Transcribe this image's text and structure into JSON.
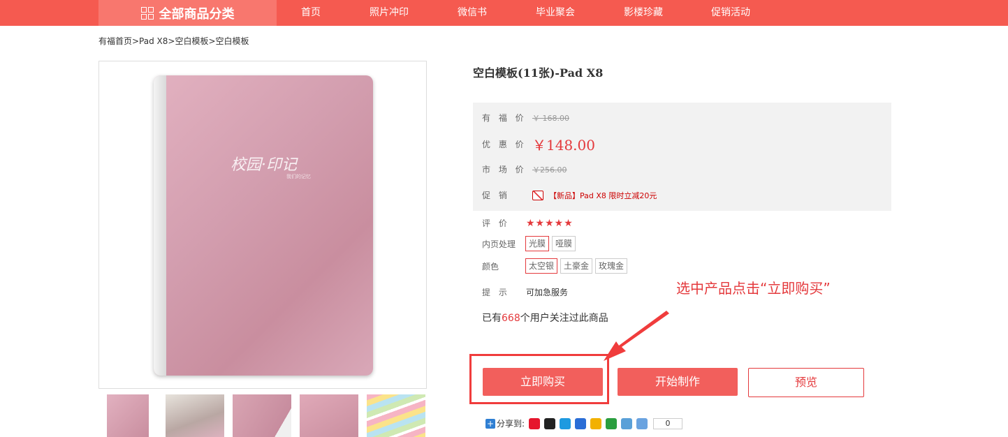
{
  "nav": {
    "all_categories": "全部商品分类",
    "items": [
      "首页",
      "照片冲印",
      "微信书",
      "毕业聚会",
      "影楼珍藏",
      "促销活动"
    ]
  },
  "breadcrumb": "有福首页>Pad X8>空白模板>空白模板",
  "album": {
    "title": "校园·印记",
    "subtitle": "我们的记忆"
  },
  "product": {
    "title": "空白模板(11张)-Pad X8",
    "youfu_label": "有 福 价",
    "youfu_price": "￥ 168.00",
    "promo_price_label": "优 惠 价",
    "promo_price": "￥148.00",
    "market_label": "市 场 价",
    "market_price": "￥256.00",
    "promotion_label": "促  销",
    "promotion_text": "【新品】Pad X8 限时立减20元",
    "rating_label": "评  价",
    "rating_stars": "★★★★★",
    "page_label": "内页处理",
    "page_options": [
      "光膜",
      "哑膜"
    ],
    "color_label": "颜色",
    "color_options": [
      "太空银",
      "土豪金",
      "玫瑰金"
    ],
    "tip_label": "提  示",
    "tip_text": "可加急服务",
    "followers_prefix": "已有",
    "followers_count": "668",
    "followers_suffix": "个用户关注过此商品"
  },
  "annotation": "选中产品点击“立即购买”",
  "buttons": {
    "buy": "立即购买",
    "make": "开始制作",
    "preview": "预览"
  },
  "share": {
    "label": "分享到:",
    "count": "0"
  }
}
